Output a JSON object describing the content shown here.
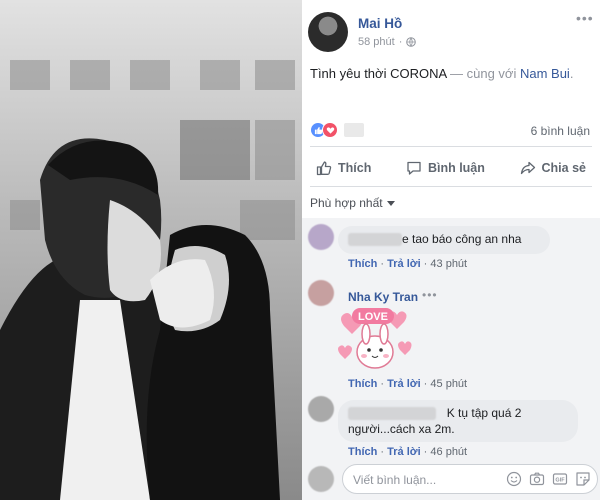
{
  "post": {
    "author": "Mai Hồ",
    "time": "58 phút",
    "text_main": "Tình yêu thời CORONA",
    "text_with": " — cùng với ",
    "tagged": "Nam Bui",
    "tagged_end": ".",
    "comment_count": "6 bình luận"
  },
  "actions": {
    "like": "Thích",
    "comment": "Bình luận",
    "share": "Chia sẻ"
  },
  "sort_label": "Phù hợp nhất",
  "comments": [
    {
      "text": "e tao báo công an nha",
      "like": "Thích",
      "reply": "Trả lời",
      "time": "43 phút"
    },
    {
      "name": "Nha Ky Tran",
      "sticker_text": "LOVE",
      "like": "Thích",
      "reply": "Trả lời",
      "time": "45 phút"
    },
    {
      "text_line1": "K tụ tập quá 2",
      "text_line2": "người...cách xa 2m.",
      "like": "Thích",
      "reply": "Trả lời",
      "time": "46 phút"
    }
  ],
  "composer": {
    "placeholder": "Viết bình luận..."
  },
  "icons": {
    "more": "more-icon",
    "globe": "globe-icon",
    "like_reaction": "like-reaction-icon",
    "love_reaction": "love-reaction-icon",
    "thumbs_up": "thumbs-up-icon",
    "chat": "chat-bubble-icon",
    "share": "share-arrow-icon",
    "emoji": "emoji-icon",
    "camera": "camera-icon",
    "gif": "gif-icon",
    "sticker": "sticker-icon"
  },
  "colors": {
    "link_blue": "#365899",
    "action_blue": "#4267b2",
    "like_blue": "#5890ff",
    "love_red": "#f25268",
    "comment_bg": "#f2f3f5",
    "bubble_bg": "#e9ebee"
  }
}
